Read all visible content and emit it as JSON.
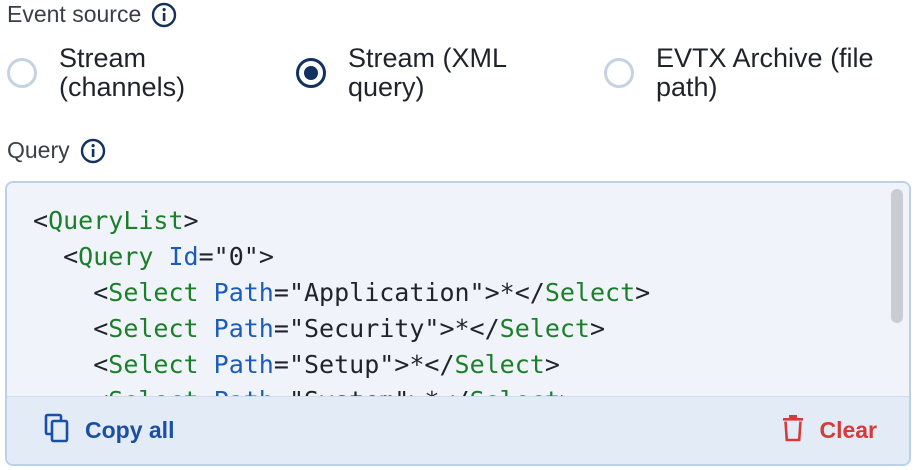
{
  "event_source": {
    "label": "Event source"
  },
  "radio_options": [
    {
      "label": "Stream\n(channels)",
      "selected": false
    },
    {
      "label": "Stream (XML\nquery)",
      "selected": true
    },
    {
      "label": "EVTX Archive (file\npath)",
      "selected": false
    }
  ],
  "query": {
    "label": "Query"
  },
  "code": {
    "line1": {
      "open": "<",
      "tag": "QueryList",
      "close": ">"
    },
    "line2": {
      "open": "<",
      "tag": "Query",
      "attr": "Id",
      "eq": "=",
      "val": "\"0\"",
      "close": ">"
    },
    "line3": {
      "open": "<",
      "tag": "Select",
      "attr": "Path",
      "eq": "=",
      "val": "\"Application\"",
      "mid": ">*</",
      "tag2": "Select",
      "close": ">"
    },
    "line4": {
      "open": "<",
      "tag": "Select",
      "attr": "Path",
      "eq": "=",
      "val": "\"Security\"",
      "mid": ">*</",
      "tag2": "Select",
      "close": ">"
    },
    "line5": {
      "open": "<",
      "tag": "Select",
      "attr": "Path",
      "eq": "=",
      "val": "\"Setup\"",
      "mid": ">*</",
      "tag2": "Select",
      "close": ">"
    },
    "line6": {
      "open": "<",
      "tag": "Select",
      "attr": "Path",
      "eq": "=",
      "val": "\"System\"",
      "mid": ">*</",
      "tag2": "Select",
      "close": ">"
    }
  },
  "footer": {
    "copy_label": "Copy all",
    "clear_label": "Clear"
  },
  "colors": {
    "accent": "#12315f",
    "tag": "#1b7f2a",
    "attr": "#1b5cb8",
    "copy": "#1a4fa6",
    "clear": "#d73a3a"
  },
  "icons": {
    "info": "info-icon",
    "copy": "copy-icon",
    "trash": "trash-icon"
  }
}
